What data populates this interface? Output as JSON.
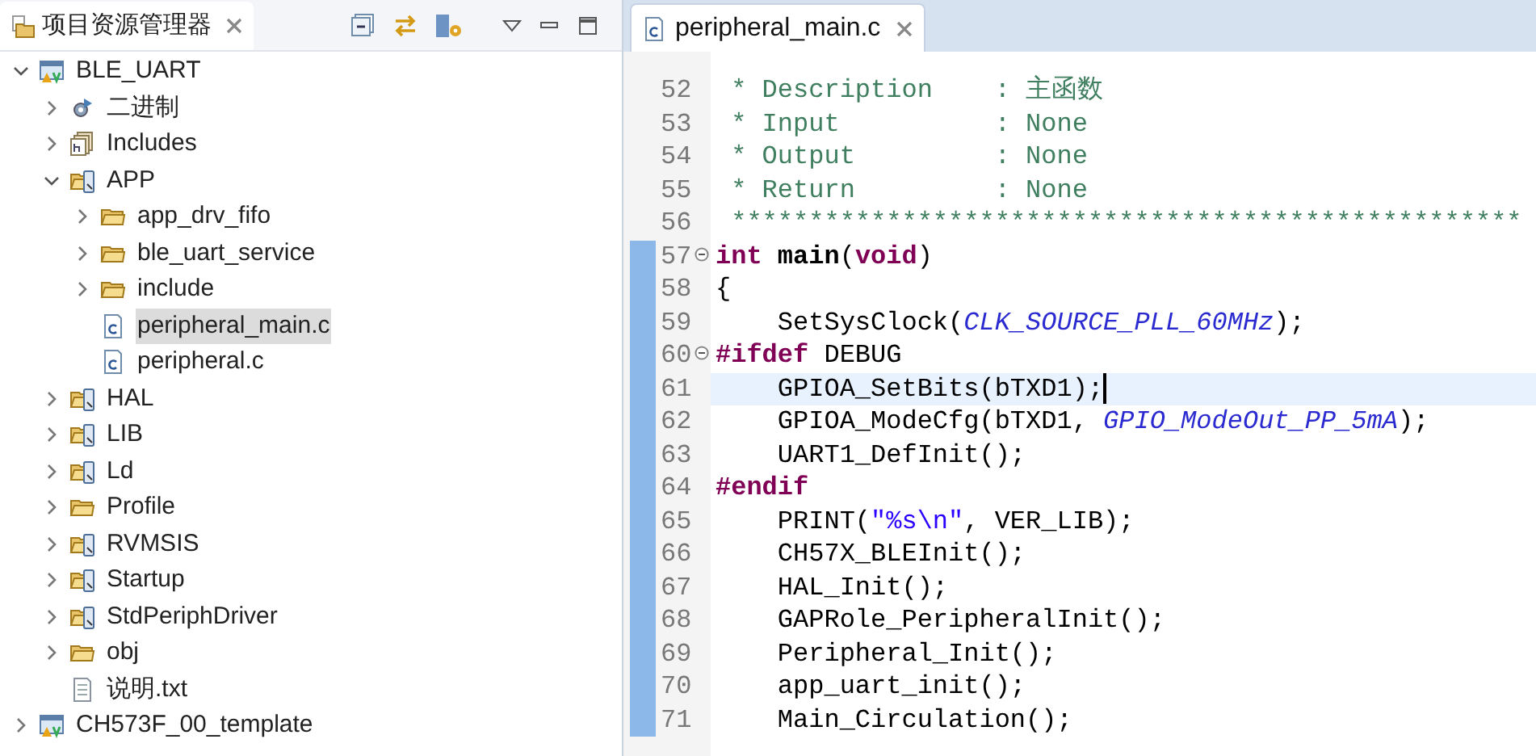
{
  "explorer": {
    "title": "项目资源管理器",
    "tree": [
      {
        "label": "BLE_UART",
        "kind": "project",
        "expanded": true,
        "selected": false,
        "children": [
          {
            "label": "二进制",
            "kind": "binaries",
            "expanded": false,
            "selected": false
          },
          {
            "label": "Includes",
            "kind": "includes",
            "expanded": false,
            "selected": false
          },
          {
            "label": "APP",
            "kind": "source-folder",
            "expanded": true,
            "selected": false,
            "children": [
              {
                "label": "app_drv_fifo",
                "kind": "folder",
                "expanded": false,
                "selected": false
              },
              {
                "label": "ble_uart_service",
                "kind": "folder",
                "expanded": false,
                "selected": false
              },
              {
                "label": "include",
                "kind": "folder",
                "expanded": false,
                "selected": false
              },
              {
                "label": "peripheral_main.c",
                "kind": "c-file",
                "selected": true
              },
              {
                "label": "peripheral.c",
                "kind": "c-file",
                "selected": false
              }
            ]
          },
          {
            "label": "HAL",
            "kind": "source-folder",
            "expanded": false,
            "selected": false
          },
          {
            "label": "LIB",
            "kind": "source-folder",
            "expanded": false,
            "selected": false
          },
          {
            "label": "Ld",
            "kind": "source-folder",
            "expanded": false,
            "selected": false
          },
          {
            "label": "Profile",
            "kind": "folder",
            "expanded": false,
            "selected": false
          },
          {
            "label": "RVMSIS",
            "kind": "source-folder",
            "expanded": false,
            "selected": false
          },
          {
            "label": "Startup",
            "kind": "source-folder",
            "expanded": false,
            "selected": false
          },
          {
            "label": "StdPeriphDriver",
            "kind": "source-folder",
            "expanded": false,
            "selected": false
          },
          {
            "label": "obj",
            "kind": "folder",
            "expanded": false,
            "selected": false
          },
          {
            "label": "说明.txt",
            "kind": "text-file",
            "selected": false
          }
        ]
      },
      {
        "label": "CH573F_00_template",
        "kind": "project",
        "expanded": false,
        "selected": false
      }
    ]
  },
  "editor": {
    "tab": "peripheral_main.c",
    "lines": [
      {
        "number": "52",
        "foldable": false,
        "in_range": false,
        "current": false,
        "cursor": false,
        "segments": [
          {
            "kind": "comment",
            "text": " * Description    : 主函数"
          }
        ]
      },
      {
        "number": "53",
        "foldable": false,
        "in_range": false,
        "current": false,
        "cursor": false,
        "segments": [
          {
            "kind": "comment",
            "text": " * Input          : None"
          }
        ]
      },
      {
        "number": "54",
        "foldable": false,
        "in_range": false,
        "current": false,
        "cursor": false,
        "segments": [
          {
            "kind": "comment",
            "text": " * Output         : None"
          }
        ]
      },
      {
        "number": "55",
        "foldable": false,
        "in_range": false,
        "current": false,
        "cursor": false,
        "segments": [
          {
            "kind": "comment",
            "text": " * Return         : None"
          }
        ]
      },
      {
        "number": "56",
        "foldable": false,
        "in_range": false,
        "current": false,
        "cursor": false,
        "segments": [
          {
            "kind": "comment",
            "text": " ***************************************************"
          }
        ]
      },
      {
        "number": "57",
        "foldable": true,
        "in_range": true,
        "current": false,
        "cursor": false,
        "segments": [
          {
            "kind": "keyword",
            "text": "int"
          },
          {
            "kind": "bold",
            "text": " main"
          },
          {
            "kind": "plain",
            "text": "("
          },
          {
            "kind": "keyword",
            "text": "void"
          },
          {
            "kind": "plain",
            "text": ")"
          }
        ]
      },
      {
        "number": "58",
        "foldable": false,
        "in_range": true,
        "current": false,
        "cursor": false,
        "segments": [
          {
            "kind": "plain",
            "text": "{"
          }
        ]
      },
      {
        "number": "59",
        "foldable": false,
        "in_range": true,
        "current": false,
        "cursor": false,
        "segments": [
          {
            "kind": "plain",
            "text": "    SetSysClock("
          },
          {
            "kind": "macro",
            "text": "CLK_SOURCE_PLL_60MHz"
          },
          {
            "kind": "plain",
            "text": ");"
          }
        ]
      },
      {
        "number": "60",
        "foldable": true,
        "in_range": true,
        "current": false,
        "cursor": false,
        "segments": [
          {
            "kind": "keyword",
            "text": "#ifdef"
          },
          {
            "kind": "plain",
            "text": " DEBUG"
          }
        ]
      },
      {
        "number": "61",
        "foldable": false,
        "in_range": true,
        "current": true,
        "cursor": true,
        "segments": [
          {
            "kind": "plain",
            "text": "    GPIOA_SetBits(bTXD1);"
          }
        ]
      },
      {
        "number": "62",
        "foldable": false,
        "in_range": true,
        "current": false,
        "cursor": false,
        "segments": [
          {
            "kind": "plain",
            "text": "    GPIOA_ModeCfg(bTXD1, "
          },
          {
            "kind": "macro",
            "text": "GPIO_ModeOut_PP_5mA"
          },
          {
            "kind": "plain",
            "text": ");"
          }
        ]
      },
      {
        "number": "63",
        "foldable": false,
        "in_range": true,
        "current": false,
        "cursor": false,
        "segments": [
          {
            "kind": "plain",
            "text": "    UART1_DefInit();"
          }
        ]
      },
      {
        "number": "64",
        "foldable": false,
        "in_range": true,
        "current": false,
        "cursor": false,
        "segments": [
          {
            "kind": "keyword",
            "text": "#endif"
          }
        ]
      },
      {
        "number": "65",
        "foldable": false,
        "in_range": true,
        "current": false,
        "cursor": false,
        "segments": [
          {
            "kind": "plain",
            "text": "    PRINT("
          },
          {
            "kind": "string",
            "text": "\"%s\\n\""
          },
          {
            "kind": "plain",
            "text": ", VER_LIB);"
          }
        ]
      },
      {
        "number": "66",
        "foldable": false,
        "in_range": true,
        "current": false,
        "cursor": false,
        "segments": [
          {
            "kind": "plain",
            "text": "    CH57X_BLEInit();"
          }
        ]
      },
      {
        "number": "67",
        "foldable": false,
        "in_range": true,
        "current": false,
        "cursor": false,
        "segments": [
          {
            "kind": "plain",
            "text": "    HAL_Init();"
          }
        ]
      },
      {
        "number": "68",
        "foldable": false,
        "in_range": true,
        "current": false,
        "cursor": false,
        "segments": [
          {
            "kind": "plain",
            "text": "    GAPRole_PeripheralInit();"
          }
        ]
      },
      {
        "number": "69",
        "foldable": false,
        "in_range": true,
        "current": false,
        "cursor": false,
        "segments": [
          {
            "kind": "plain",
            "text": "    Peripheral_Init();"
          }
        ]
      },
      {
        "number": "70",
        "foldable": false,
        "in_range": true,
        "current": false,
        "cursor": false,
        "segments": [
          {
            "kind": "plain",
            "text": "    app_uart_init();"
          }
        ]
      },
      {
        "number": "71",
        "foldable": false,
        "in_range": true,
        "current": false,
        "cursor": false,
        "segments": [
          {
            "kind": "plain",
            "text": "    Main_Circulation();"
          }
        ]
      }
    ]
  }
}
